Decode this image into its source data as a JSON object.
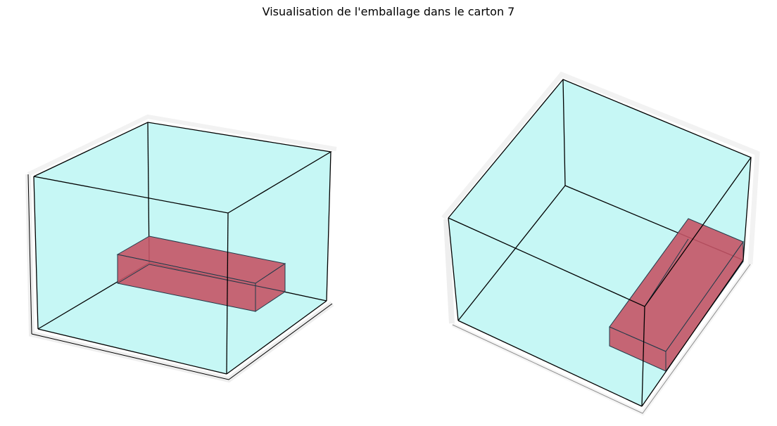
{
  "title": "Visualisation de l'emballage dans le carton 7",
  "colors": {
    "carton_fill": "#b8f5f2",
    "item_fill": "#c45466",
    "edge": "#000000",
    "item_edge": "#1f3b4a",
    "pane_floor": "#f2f2f2"
  },
  "views": [
    {
      "name": "left-view",
      "carton_label": "carton 7",
      "items": 1
    },
    {
      "name": "right-view",
      "carton_label": "carton 7",
      "items": 1
    }
  ]
}
